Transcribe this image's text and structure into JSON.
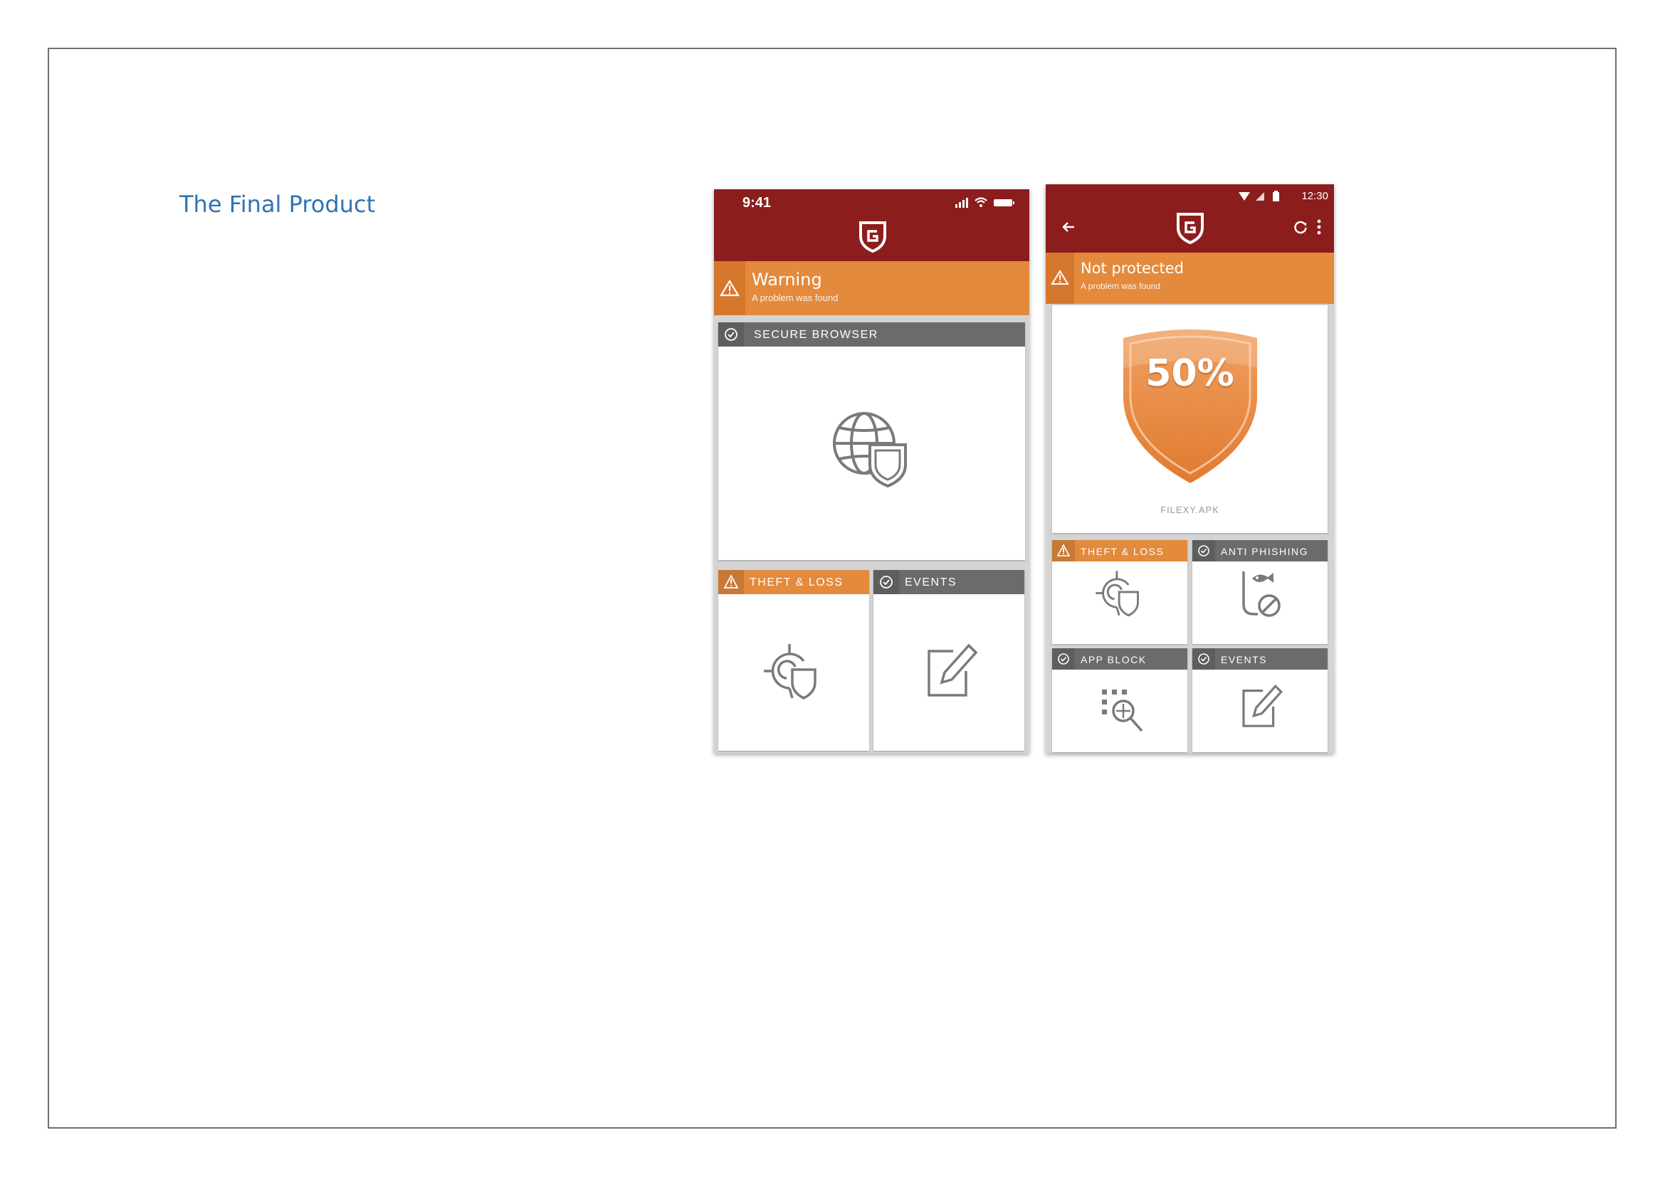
{
  "document": {
    "title": "The Final Product"
  },
  "phone1": {
    "status_time": "9:41",
    "warning_title": "Warning",
    "warning_sub": "A problem was found",
    "cards": {
      "secure_browser": "SECURE BROWSER",
      "theft_loss": "THEFT & LOSS",
      "events": "EVENTS"
    }
  },
  "phone2": {
    "status_time": "12:30",
    "warning_title": "Not protected",
    "warning_sub": "A problem was found",
    "protection_percent": "50%",
    "file_name": "FILEXY.APK",
    "cards": {
      "theft_loss": "THEFT & LOSS",
      "anti_phishing": "ANTI PHISHING",
      "app_block": "APP BLOCK",
      "events": "EVENTS"
    }
  },
  "colors": {
    "brand_red": "#8c1d1d",
    "warning_orange": "#e38a3d",
    "header_gray": "#6b6b6b",
    "title_blue": "#2e74b5"
  }
}
